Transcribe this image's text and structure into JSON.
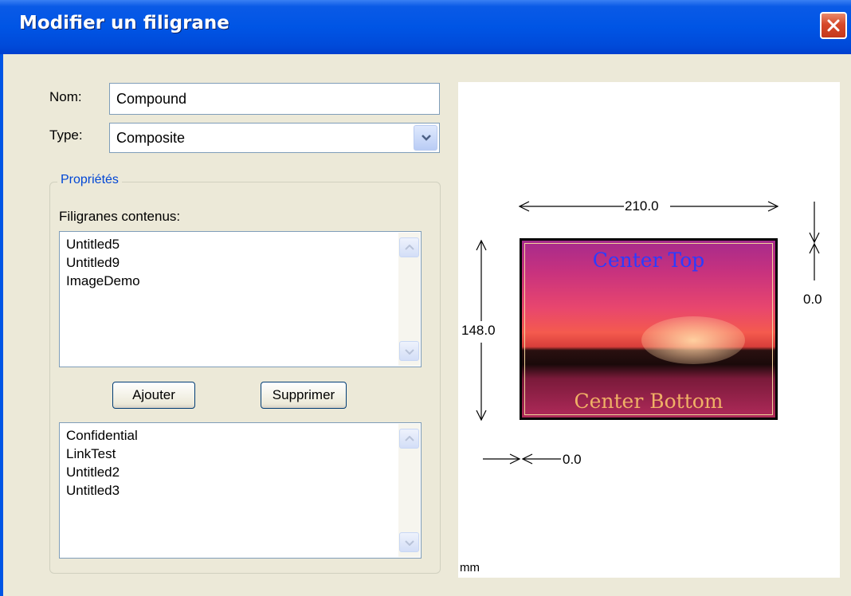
{
  "window": {
    "title": "Modifier un filigrane"
  },
  "form": {
    "name_label": "Nom:",
    "name_value": "Compound",
    "type_label": "Type:",
    "type_value": "Composite"
  },
  "properties": {
    "group_title": "Propriétés",
    "contained_label": "Filigranes contenus:",
    "contained_items": [
      "Untitled5",
      "Untitled9",
      "ImageDemo"
    ],
    "add_label": "Ajouter",
    "remove_label": "Supprimer",
    "available_items": [
      "Confidential",
      "LinkTest",
      "Untitled2",
      "Untitled3"
    ]
  },
  "preview": {
    "width": "210.0",
    "height": "148.0",
    "right_offset": "0.0",
    "bottom_offset": "0.0",
    "unit": "mm",
    "image_top_text": "Center Top",
    "image_bottom_text": "Center Bottom"
  },
  "colors": {
    "titlebar": "#0055e5",
    "group_title": "#0046d5",
    "close": "#d6492a"
  }
}
